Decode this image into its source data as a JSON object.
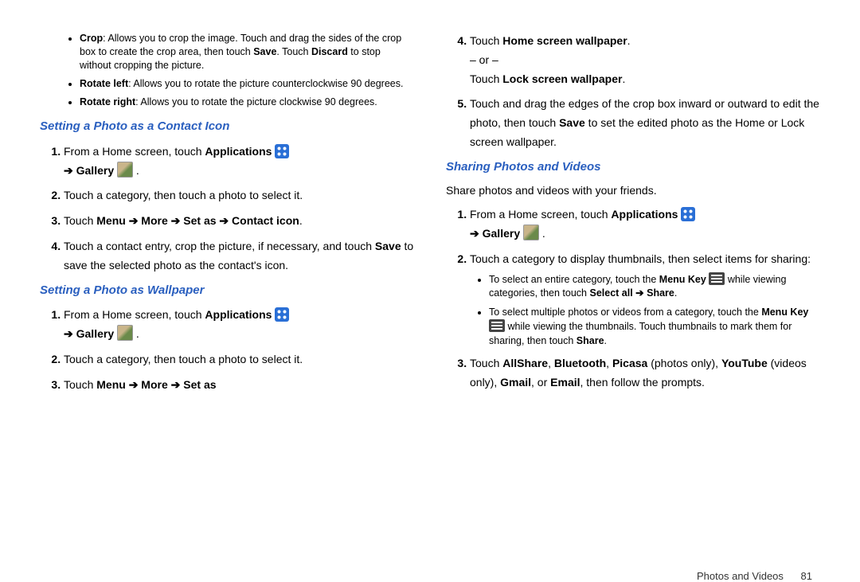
{
  "left": {
    "bullets_top": [
      {
        "label": "Crop",
        "text": ": Allows you to crop the image. Touch and drag the sides of the crop box to create the crop area, then touch ",
        "b1": "Save",
        "mid": ". Touch ",
        "b2": "Discard",
        "tail": " to stop without cropping the picture."
      },
      {
        "label": "Rotate left",
        "text": ": Allows you to rotate the picture counterclockwise 90 degrees."
      },
      {
        "label": "Rotate right",
        "text": ": Allows you to rotate the picture clockwise 90 degrees."
      }
    ],
    "h_contact": "Setting a Photo as a Contact Icon",
    "contact_steps": {
      "s1a": "From a Home screen, touch ",
      "s1b": "Applications",
      "s1c": "Gallery",
      "s2": "Touch a category, then touch a photo to select it.",
      "s3a": "Touch ",
      "s3b": "Menu ➔ More ➔ Set as ➔ Contact icon",
      "s4a": "Touch a contact entry, crop the picture, if necessary, and touch ",
      "s4b": "Save",
      "s4c": " to save the selected photo as the contact's icon."
    },
    "h_wall": "Setting a Photo as Wallpaper",
    "wall_steps": {
      "s1a": "From a Home screen, touch ",
      "s1b": "Applications",
      "s1c": "Gallery",
      "s2": "Touch a category, then touch a photo to select it.",
      "s3a": "Touch ",
      "s3b": "Menu ➔ More ➔ Set as"
    }
  },
  "right": {
    "wall_steps": {
      "s4a": "Touch ",
      "s4b": "Home screen wallpaper",
      "s4c": ".",
      "s4or": "– or –",
      "s4d": "Touch ",
      "s4e": "Lock screen wallpaper",
      "s4f": ".",
      "s5a": "Touch and drag the edges of the crop box inward or outward to edit the photo, then touch ",
      "s5b": "Save",
      "s5c": " to set the edited photo as the Home or Lock screen wallpaper."
    },
    "h_share": "Sharing Photos and Videos",
    "share_intro": "Share photos and videos with your friends.",
    "share_steps": {
      "s1a": "From a Home screen, touch ",
      "s1b": "Applications",
      "s1c": "Gallery",
      "s2": "Touch a category to display thumbnails, then select items for sharing:",
      "bullets": [
        {
          "a": "To select an entire category, touch the ",
          "b": "Menu Key",
          "c": " while viewing categories, then touch ",
          "d": "Select all ➔ Share",
          "e": "."
        },
        {
          "a": "To select multiple photos or videos from a category, touch the ",
          "b": "Menu Key",
          "c": " while viewing the thumbnails. Touch thumbnails to mark them for sharing, then touch ",
          "d": "Share",
          "e": "."
        }
      ],
      "s3a": "Touch ",
      "s3b": "AllShare",
      "s3c": ", ",
      "s3d": "Bluetooth",
      "s3e": ", ",
      "s3f": "Picasa",
      "s3g": " (photos only), ",
      "s3h": "YouTube",
      "s3i": " (videos only), ",
      "s3j": "Gmail",
      "s3k": ", or ",
      "s3l": "Email",
      "s3m": ", then follow the prompts."
    }
  },
  "footer": {
    "section": "Photos and Videos",
    "page": "81"
  }
}
